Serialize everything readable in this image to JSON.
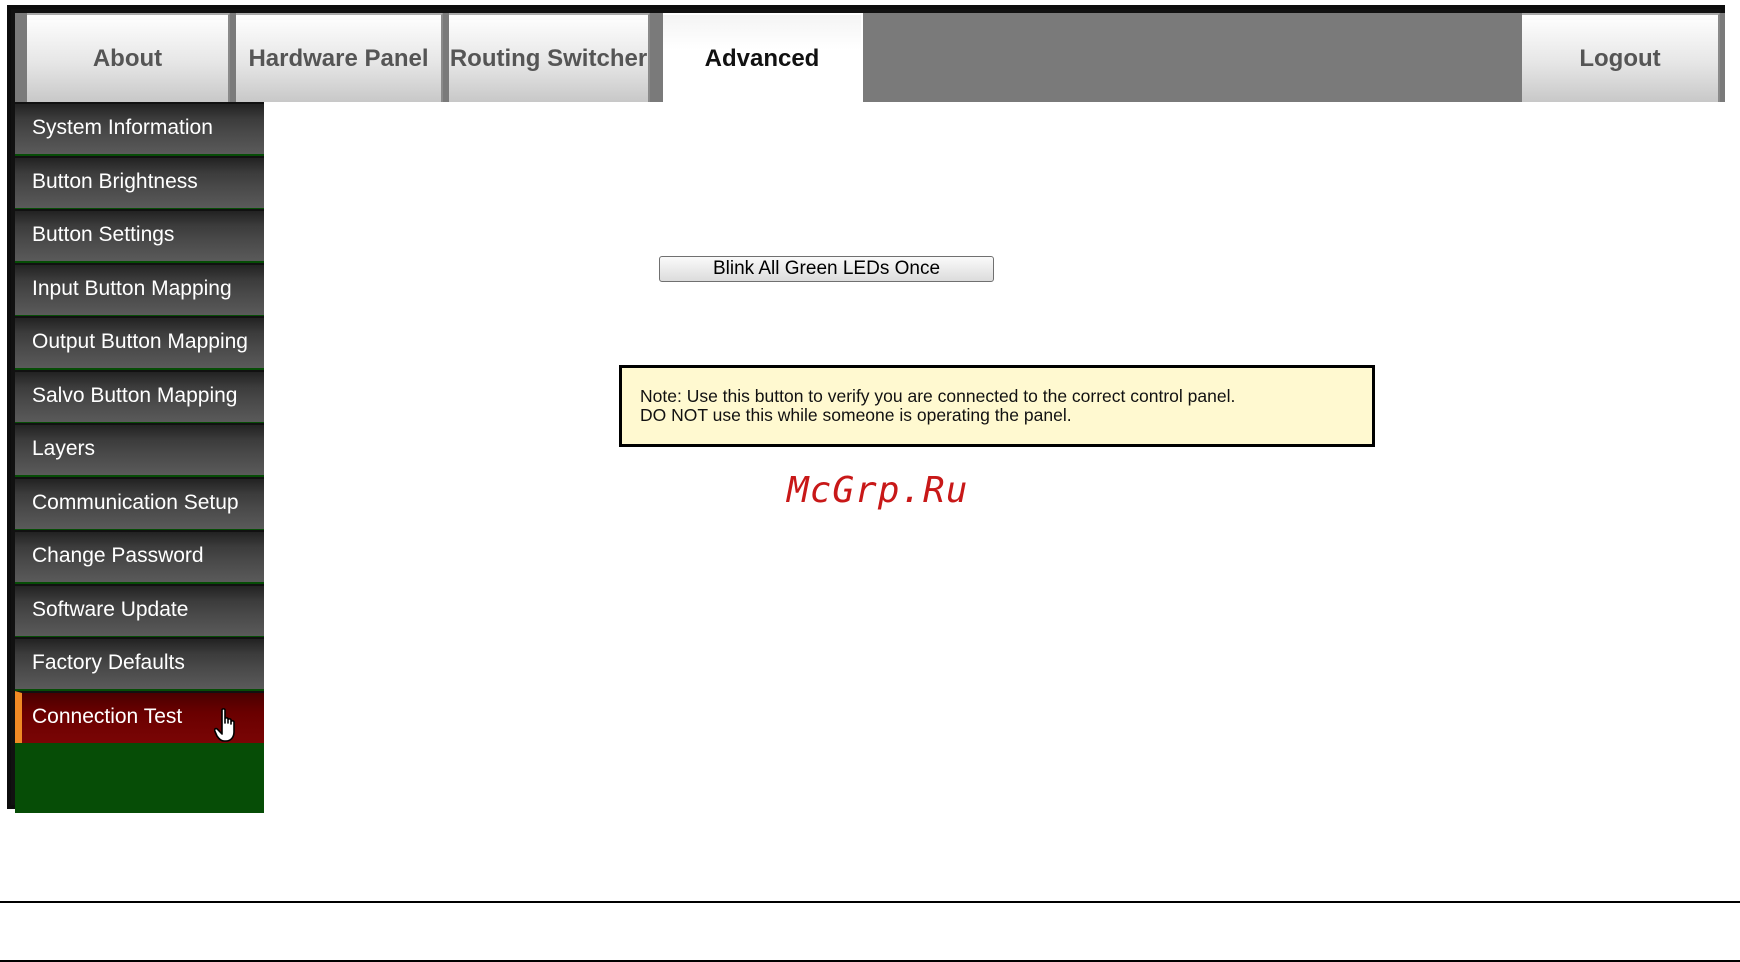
{
  "tabs": [
    {
      "label": "About"
    },
    {
      "label": "Hardware Panel"
    },
    {
      "label": "Routing Switcher"
    },
    {
      "label": "Advanced"
    }
  ],
  "logout_label": "Logout",
  "active_tab": "Advanced",
  "sidebar": {
    "items": [
      {
        "label": "System Information"
      },
      {
        "label": "Button Brightness"
      },
      {
        "label": "Button Settings"
      },
      {
        "label": "Input Button Mapping"
      },
      {
        "label": "Output Button Mapping"
      },
      {
        "label": "Salvo Button Mapping"
      },
      {
        "label": "Layers"
      },
      {
        "label": "Communication Setup"
      },
      {
        "label": "Change Password"
      },
      {
        "label": "Software Update"
      },
      {
        "label": "Factory Defaults"
      },
      {
        "label": "Connection Test"
      }
    ],
    "active_item": "Connection Test"
  },
  "main": {
    "blink_button_label": "Blink All Green LEDs Once",
    "note_line1": "Note: Use this button to verify you are connected to the correct control panel.",
    "note_line2": "DO NOT use this while someone is operating the panel."
  },
  "watermark": "McGrp.Ru",
  "colors": {
    "sidebar_active": "#6a0000",
    "sidebar_active_marker": "#f08a24",
    "sidebar_fill": "#064d06",
    "note_background": "#fff9d0"
  }
}
